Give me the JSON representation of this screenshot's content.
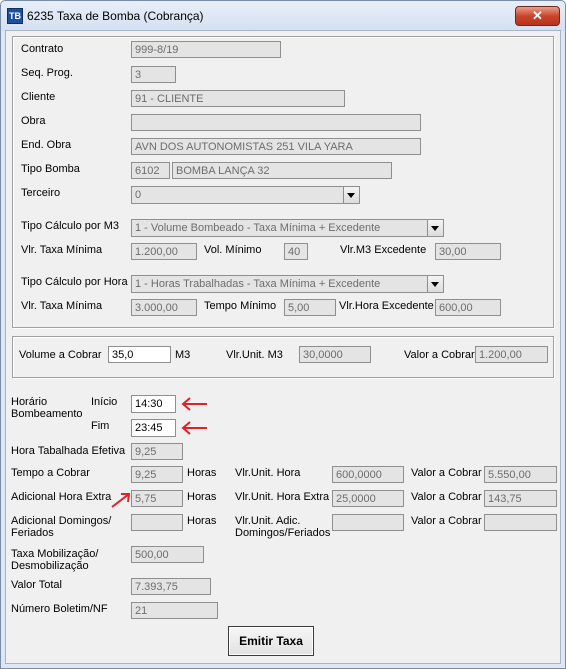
{
  "window": {
    "title": "6235 Taxa de Bomba (Cobrança)",
    "icon": "app-icon",
    "close_label": "✕"
  },
  "contrato": {
    "label": "Contrato",
    "value": "999-8/19"
  },
  "seq_prog": {
    "label": "Seq. Prog.",
    "value": "3"
  },
  "cliente": {
    "label": "Cliente",
    "value": "91 - CLIENTE"
  },
  "obra": {
    "label": "Obra",
    "value": ""
  },
  "end_obra": {
    "label": "End. Obra",
    "value": "AVN DOS AUTONOMISTAS 251  VILA YARA"
  },
  "tipo_bomba": {
    "label": "Tipo Bomba",
    "code": "6102",
    "name": "BOMBA LANÇA 32"
  },
  "terceiro": {
    "label": "Terceiro",
    "value": "0"
  },
  "calc_m3": {
    "label": "Tipo Cálculo por M3",
    "value": "1 - Volume Bombeado - Taxa Mínima + Excedente",
    "taxa_label": "Vlr. Taxa Mínima",
    "taxa_value": "1.200,00",
    "min_label": "Vol. Mínimo",
    "min_value": "40",
    "exc_label": "Vlr.M3 Excedente",
    "exc_value": "30,00"
  },
  "calc_hora": {
    "label": "Tipo Cálculo por Hora",
    "value": "1 - Horas Trabalhadas - Taxa Mínima + Excedente",
    "taxa_label": "Vlr. Taxa Mínima",
    "taxa_value": "3.000,00",
    "min_label": "Tempo Mínimo",
    "min_value": "5,00",
    "exc_label": "Vlr.Hora Excedente",
    "exc_value": "600,00"
  },
  "volume": {
    "label": "Volume a Cobrar",
    "value": "35,0",
    "unit": "M3",
    "unit_label": "Vlr.Unit. M3",
    "unit_value": "30,0000",
    "total_label": "Valor a Cobrar",
    "total_value": "1.200,00"
  },
  "horario": {
    "label_line1": "Horário",
    "label_line2": "Bombeamento",
    "inicio_label": "Início",
    "inicio_value": "14:30",
    "fim_label": "Fim",
    "fim_value": "23:45"
  },
  "hora_efetiva": {
    "label": "Hora Tabalhada Efetiva",
    "value": "9,25"
  },
  "tempo": {
    "label": "Tempo a Cobrar",
    "value": "9,25",
    "unit": "Horas",
    "unit_label": "Vlr.Unit. Hora",
    "unit_value": "600,0000",
    "total_label": "Valor a Cobrar",
    "total_value": "5.550,00"
  },
  "adicional_extra": {
    "label": "Adicional Hora Extra",
    "value": "5,75",
    "unit": "Horas",
    "unit_label": "Vlr.Unit. Hora Extra",
    "unit_value": "25,0000",
    "total_label": "Valor a Cobrar",
    "total_value": "143,75"
  },
  "adicional_dom": {
    "label_line1": "Adicional Domingos/",
    "label_line2": "Feriados",
    "value": "",
    "unit": "Horas",
    "unit_label_line1": "Vlr.Unit. Adic.",
    "unit_label_line2": "Domingos/Feriados",
    "unit_value": "",
    "total_label": "Valor a Cobrar",
    "total_value": ""
  },
  "mobilizacao": {
    "label_line1": "Taxa Mobilização/",
    "label_line2": "Desmobilização",
    "value": "500,00"
  },
  "valor_total": {
    "label": "Valor Total",
    "value": "7.393,75"
  },
  "boletim": {
    "label": "Número Boletim/NF",
    "value": "21"
  },
  "emitir_label": "Emitir Taxa",
  "accent": "#e0202a"
}
